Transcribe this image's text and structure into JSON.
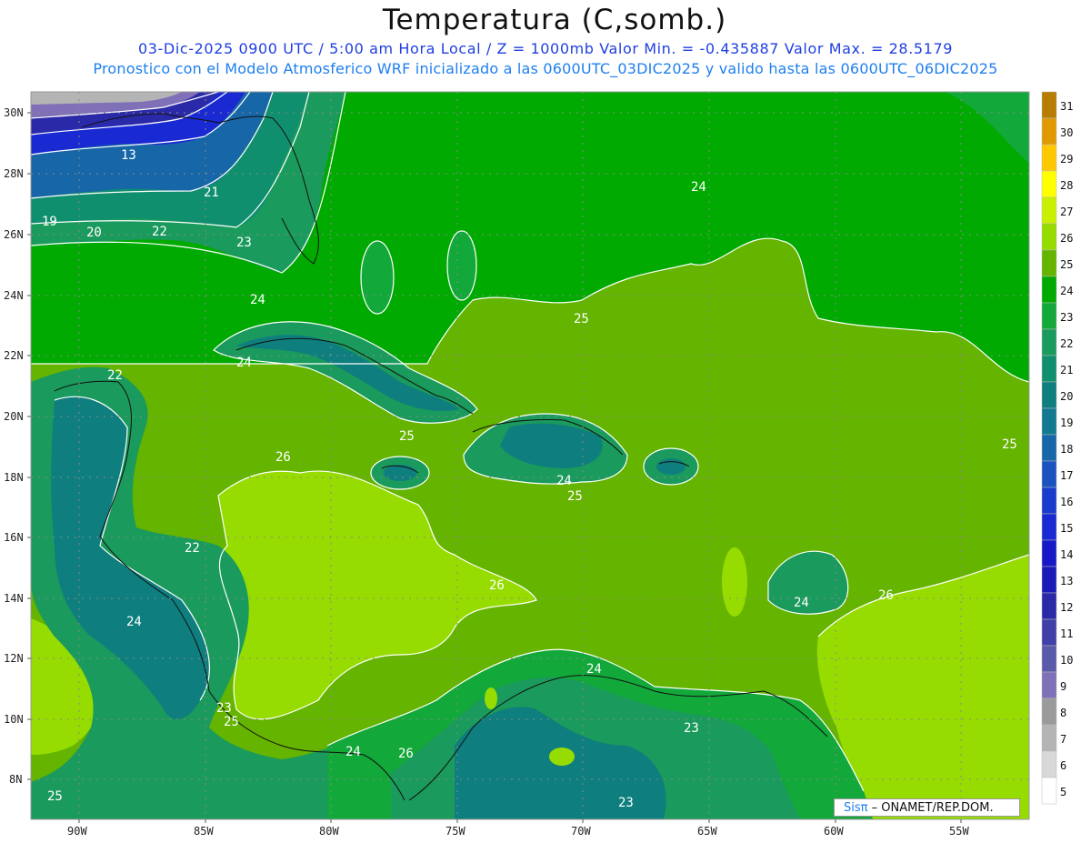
{
  "title": "Temperatura (C,somb.)",
  "subtitle_line1": "03-Dic-2025  0900 UTC / 5:00 am Hora Local / Z = 1000mb  Valor Min. = -0.435887  Valor Max. = 28.5179",
  "subtitle_line2": "Pronostico con el Modelo Atmosferico WRF inicializado a las 0600UTC_03DIC2025 y valido hasta las  0600UTC_06DIC2025",
  "map": {
    "lat_labels": [
      "30N",
      "28N",
      "26N",
      "24N",
      "22N",
      "20N",
      "18N",
      "16N",
      "14N",
      "12N",
      "10N",
      "8N"
    ],
    "lon_labels": [
      "90W",
      "85W",
      "80W",
      "75W",
      "70W",
      "65W",
      "60W",
      "55W"
    ],
    "contour_labels": [
      {
        "text": "13"
      },
      {
        "text": "19"
      },
      {
        "text": "20"
      },
      {
        "text": "21"
      },
      {
        "text": "22"
      },
      {
        "text": "23"
      },
      {
        "text": "24"
      },
      {
        "text": "24"
      },
      {
        "text": "25"
      },
      {
        "text": "24"
      },
      {
        "text": "22"
      },
      {
        "text": "25"
      },
      {
        "text": "26"
      },
      {
        "text": "24"
      },
      {
        "text": "25"
      },
      {
        "text": "25"
      },
      {
        "text": "22"
      },
      {
        "text": "26"
      },
      {
        "text": "24"
      },
      {
        "text": "26"
      },
      {
        "text": "24"
      },
      {
        "text": "23"
      },
      {
        "text": "25"
      },
      {
        "text": "24"
      },
      {
        "text": "26"
      },
      {
        "text": "24"
      },
      {
        "text": "23"
      },
      {
        "text": "23"
      },
      {
        "text": "25"
      }
    ]
  },
  "colorbar": {
    "labels": [
      "31",
      "30",
      "29",
      "28",
      "27",
      "26",
      "25",
      "24",
      "23",
      "22",
      "21",
      "20",
      "19",
      "18",
      "17",
      "16",
      "15",
      "14",
      "13",
      "12",
      "11",
      "10",
      "9",
      "8",
      "7",
      "6",
      "5"
    ],
    "colors": [
      "#b87c00",
      "#e09a00",
      "#ffc800",
      "#ffff00",
      "#c8f000",
      "#96dc00",
      "#64b400",
      "#00aa00",
      "#13a83a",
      "#1a9a5c",
      "#108f6e",
      "#0f7e7e",
      "#127a90",
      "#1666a8",
      "#1a52c0",
      "#1a3ccc",
      "#1a2ad2",
      "#1818c8",
      "#1a1ab8",
      "#2a2aa8",
      "#4040a8",
      "#5a5aaa",
      "#8070b8",
      "#9a9a9a",
      "#b4b4b4",
      "#d8d8d8",
      "#ffffff"
    ]
  },
  "credit": {
    "sis": "Sisπ",
    "rest": " – ONAMET/REP.DOM."
  }
}
